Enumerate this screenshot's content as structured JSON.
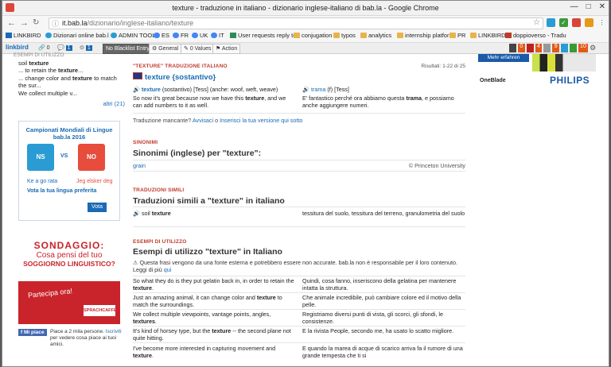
{
  "window": {
    "title": "texture - traduzione in italiano - dizionario inglese-italiano di bab.la - Google Chrome",
    "controls": [
      "—",
      "□",
      "✕"
    ]
  },
  "address": {
    "host": "it.bab.la",
    "path": "/dizionario/inglese-italiano/texture"
  },
  "bookmarks": [
    "LINKBIRD",
    "Dizionari online bab.l",
    "ADMIN TOOL",
    "ES",
    "FR",
    "UK",
    "IT",
    "User requests reply to",
    "conjugation",
    "typos",
    "analytics",
    "internship platform",
    "PR",
    "LINKBIRD",
    "doppioverso - Tradu"
  ],
  "linkbird": {
    "logo": "linkbird",
    "counts": [
      "0",
      "1",
      "1"
    ],
    "no_blacklist": "No Blacklist Entry",
    "general": "General",
    "values": "0 Values",
    "action": "Action"
  },
  "ext_badges": [
    "0",
    "4",
    "9",
    "10"
  ],
  "left": {
    "heading": "ESEMPI DI UTILIZZO",
    "lines": [
      {
        "pre": "soil ",
        "b": "texture",
        "post": ""
      },
      {
        "pre": "... to retain the ",
        "b": "texture",
        "post": "..."
      },
      {
        "pre": "... change color and ",
        "b": "texture",
        "post": " to match"
      },
      {
        "pre": "the sur...",
        "b": "",
        "post": ""
      },
      {
        "pre": "We collect multiple v...",
        "b": "",
        "post": ""
      }
    ],
    "more": "altri (21)",
    "contest": {
      "title": "Campionati Mondiali di Lingue bab.la 2016",
      "left_team": "NS",
      "right_team": "NO",
      "vs": "VS",
      "left_caption": "Ke a go rata",
      "right_caption": "Jeg elsker deg",
      "vote_text": "Vota la tua lingua preferita",
      "vote_btn": "Vota"
    },
    "survey": {
      "title": "SONDAGGIO:",
      "q1": "Cosa pensi del tuo",
      "q2": "SOGGIORNO LINGUISTICO?",
      "cta": "Partecipa ora!",
      "brand": "SPRACHCAFFE"
    },
    "fb": {
      "like": "Mi piace",
      "text": "Piace a 2 mila persone.",
      "link": "Iscriviti",
      "text2": " per vedere cosa piace ai tuoi amici."
    }
  },
  "main": {
    "section1": {
      "label": "\"TEXTURE\" TRADUZIONE ITALIANO",
      "results": "Risultati: 1-22 di 25",
      "entry": "texture {sostantivo}",
      "en_word": "texture",
      "en_meta": " (sostantivo) [Tess] (anche: woof, weft, weave)",
      "it_word": "trama",
      "it_meta": " (f) [Tess]",
      "en_ex_pre": "So now it's great because now we have this ",
      "en_ex_b": "texture",
      "en_ex_post": ", and we can add numbers to it as well.",
      "it_ex_pre": "E' fantastico perché ora abbiamo questa ",
      "it_ex_b": "trama",
      "it_ex_post": ", e possiamo anche aggiungere numeri.",
      "missing": "Traduzione mancante?",
      "report": "Avvisaci",
      "or": " o ",
      "insert": "Inserisci la tua versione qui sotto"
    },
    "section2": {
      "label": "SINONIMI",
      "heading": "Sinonimi (inglese) per \"texture\":",
      "syn": "grain",
      "credit": "© Princeton University"
    },
    "section3": {
      "label": "TRADUZIONI SIMILI",
      "heading": "Traduzioni simili a \"texture\" in italiano",
      "en_pre": "soil ",
      "en_b": "texture",
      "it": "tessitura del suolo, tessitura del terreno, granulometria del suolo"
    },
    "section4": {
      "label": "ESEMPI DI UTILIZZO",
      "heading": "Esempi di utilizzo \"texture\" in Italiano",
      "warn": "Questa frasi vengono da una fonte esterna e potrebbero essere non accurate. bab.la non è responsabile per il loro contenuto. Leggi di più",
      "warn_link": "qui",
      "rows": [
        {
          "en_pre": "So what they do is they put gelatin back in, in order to retain the ",
          "en_b": "texture",
          "en_post": ".",
          "it": "Quindi, cosa fanno, inseriscono della gelatina per mantenere intatta la struttura."
        },
        {
          "en_pre": "Just an amazing animal, it can change color and ",
          "en_b": "texture",
          "en_post": " to match the surroundings.",
          "it": "Che animale incredibile, può cambiare colore ed il motivo della pelle."
        },
        {
          "en_pre": "We collect multiple viewpoints, vantage points, angles, ",
          "en_b": "textures",
          "en_post": ".",
          "it": "Registriamo diversi punti di vista, gli scorci, gli sfondi, le consistenze."
        },
        {
          "en_pre": "It's kind of horsey type, but the ",
          "en_b": "texture",
          "en_post": " -- the second plane not quite hitting.",
          "it": "E la rivista People, secondo me, ha usato lo scatto migliore."
        },
        {
          "en_pre": "I've become more interested in capturing movement and ",
          "en_b": "texture",
          "en_post": ".",
          "it": "E quando la marea di acque di scarico arriva fa il rumore di una grande tempesta che ti si"
        }
      ]
    }
  },
  "ad": {
    "button": "Mehr erfahren",
    "product": "OneBlade",
    "brand": "PHILIPS"
  }
}
